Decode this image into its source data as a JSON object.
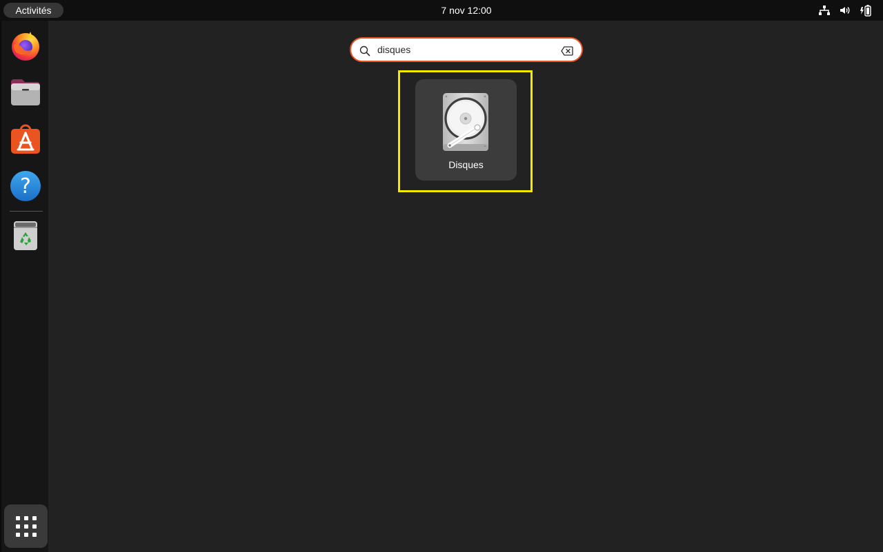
{
  "topbar": {
    "activities_label": "Activités",
    "clock": "7 nov  12:00",
    "tray_icons": [
      "network-icon",
      "volume-icon",
      "battery-icon"
    ]
  },
  "dock": {
    "apps": [
      {
        "name": "firefox",
        "icon": "firefox-icon"
      },
      {
        "name": "files",
        "icon": "files-icon"
      },
      {
        "name": "app-center",
        "icon": "app-center-icon"
      },
      {
        "name": "help",
        "icon": "help-icon"
      },
      {
        "name": "trash",
        "icon": "trash-icon"
      }
    ],
    "show_apps_icon": "grid-icon"
  },
  "search": {
    "value": "disques",
    "accent_color": "#e95420"
  },
  "results": [
    {
      "label": "Disques",
      "icon": "disks-icon",
      "highlighted": true
    }
  ],
  "colors": {
    "background": "#222222",
    "highlight": "#f5ea00",
    "accent": "#e95420"
  }
}
